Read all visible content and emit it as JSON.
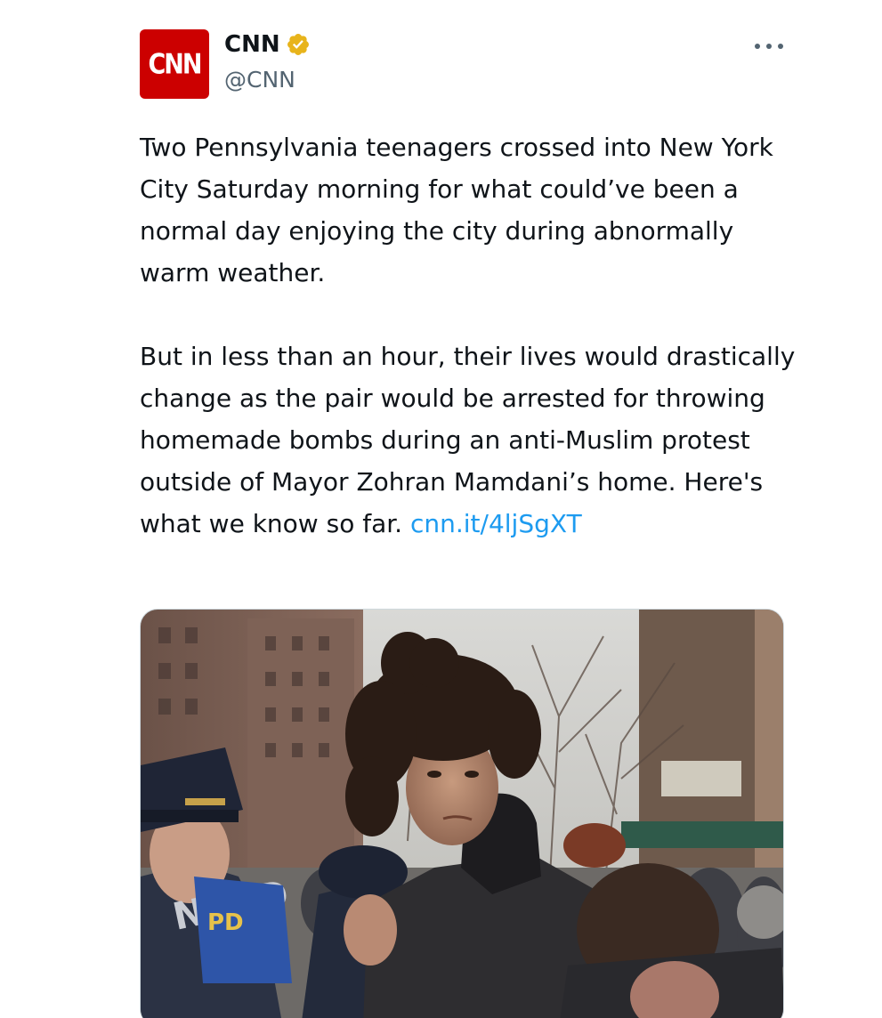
{
  "account": {
    "avatar_text": "CNN",
    "display_name": "CNN",
    "handle": "@CNN",
    "verified_badge_color": "#e8b41b",
    "brand_color": "#cc0000"
  },
  "tweet": {
    "paragraph_1": "Two Pennsylvania teenagers crossed into New York City Saturday morning for what could’ve been a normal day enjoying the city during abnormally warm weather.",
    "paragraph_2_text": "But in less than an hour, their lives would drastically change as the pair would be arrested for throwing homemade bombs during an anti-Muslim protest outside of Mayor Zohran Mamdani’s home. Here's what we know so far. ",
    "link_text": "cnn.it/4ljSgXT",
    "link_color": "#1d9bf0"
  },
  "media": {
    "visible_signage": [
      "PD",
      "NYPD"
    ]
  },
  "icons": {
    "verified": "verified-badge-icon",
    "more": "more-options-icon"
  }
}
